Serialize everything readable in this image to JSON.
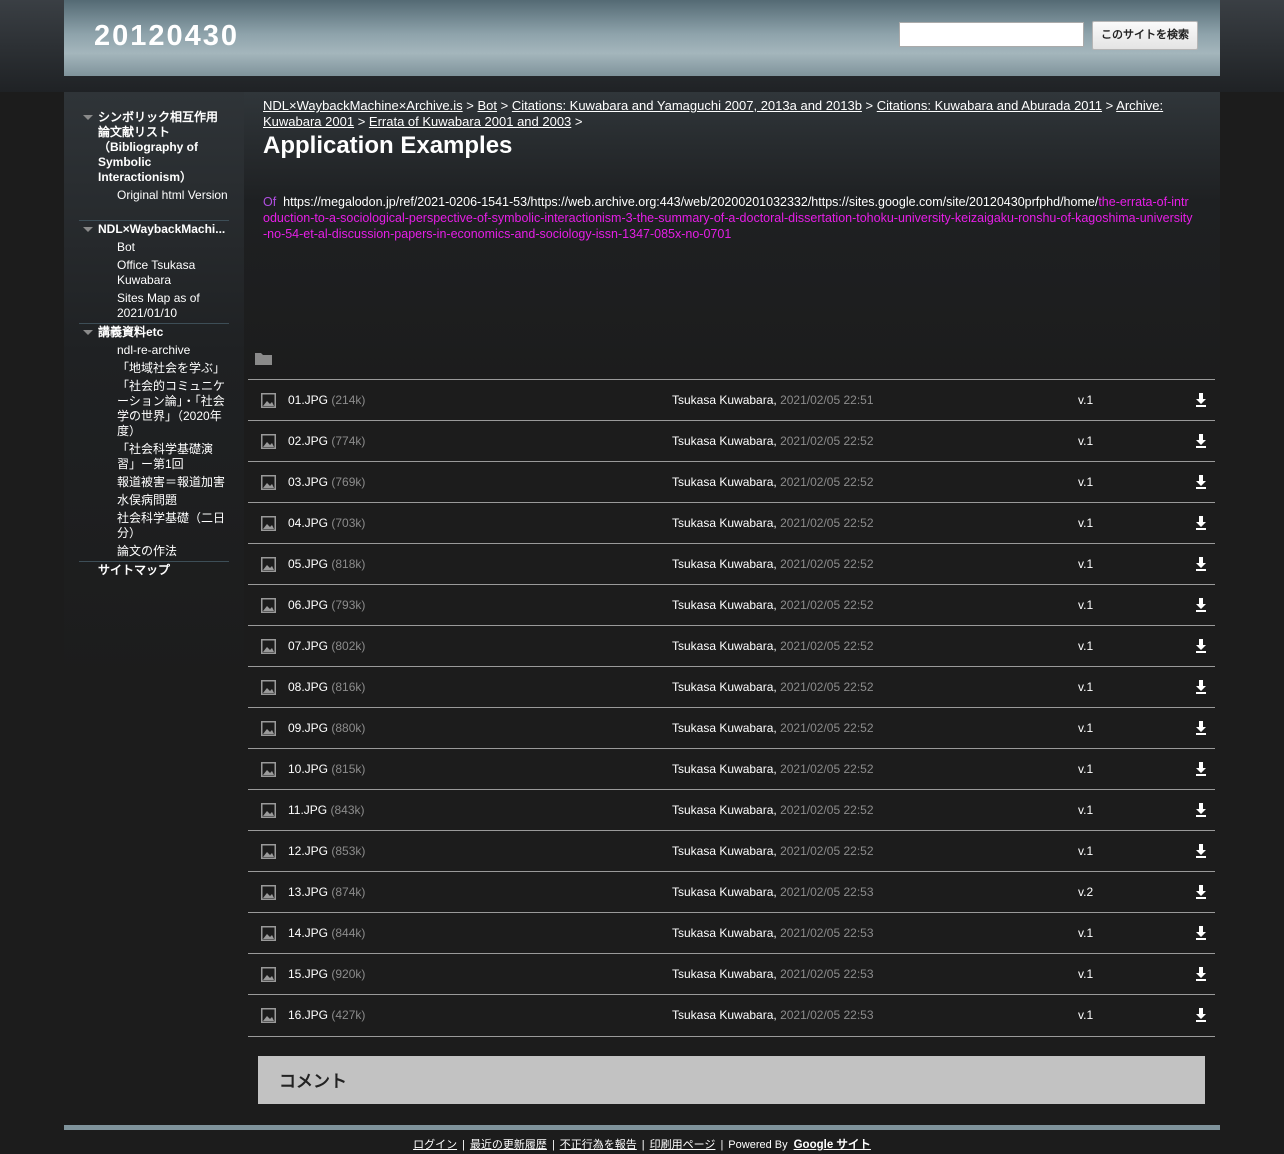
{
  "header": {
    "site_title": "20120430",
    "search_placeholder": "",
    "search_button": "このサイトを検索"
  },
  "sidebar": {
    "sections": [
      {
        "label": "シンボリック相互作用論文献リスト（Bibliography of Symbolic Interactionism）",
        "children": [
          "Original html Version"
        ]
      },
      {
        "label": "NDL×WaybackMachi...",
        "children": [
          "Bot",
          "Office Tsukasa Kuwabara",
          "Sites Map as of 2021/01/10"
        ]
      },
      {
        "label": "講義資料etc",
        "children": [
          "ndl-re-archive",
          "「地域社会を学ぶ」",
          "「社会的コミュニケーション論」・「社会学の世界」（2020年度）",
          "「社会科学基礎演習」ー第1回",
          "報道被害＝報道加害",
          "水俣病問題",
          "社会科学基礎（二日分）",
          "論文の作法"
        ]
      }
    ],
    "sitemap": "サイトマップ"
  },
  "breadcrumb": {
    "items": [
      "NDL×WaybackMachine×Archive.is",
      "Bot",
      "Citations: Kuwabara and Yamaguchi 2007, 2013a and 2013b",
      "Citations: Kuwabara and Aburada 2011",
      "Archive: Kuwabara 2001",
      "Errata of Kuwabara 2001 and 2003"
    ],
    "separator": ">"
  },
  "page": {
    "title": "Application Examples",
    "body_of": "Of",
    "body_url": "https://megalodon.jp/ref/2021-0206-1541-53/https://web.archive.org:443/web/20200201032332/https://sites.google.com/site/20120430prfphd/home/",
    "body_link": "the-errata-of-introduction-to-a-sociological-perspective-of-symbolic-interactionism-3-the-summary-of-a-doctoral-dissertation-tohoku-university-keizaigaku-ronshu-of-kagoshima-university-no-54-et-al-discussion-papers-in-economics-and-sociology-issn-1347-085x-no-0701"
  },
  "files": [
    {
      "name": "01.JPG",
      "size": "(214k)",
      "author": "Tsukasa Kuwabara,",
      "date": "2021/02/05 22:51",
      "version": "v.1"
    },
    {
      "name": "02.JPG",
      "size": "(774k)",
      "author": "Tsukasa Kuwabara,",
      "date": "2021/02/05 22:52",
      "version": "v.1"
    },
    {
      "name": "03.JPG",
      "size": "(769k)",
      "author": "Tsukasa Kuwabara,",
      "date": "2021/02/05 22:52",
      "version": "v.1"
    },
    {
      "name": "04.JPG",
      "size": "(703k)",
      "author": "Tsukasa Kuwabara,",
      "date": "2021/02/05 22:52",
      "version": "v.1"
    },
    {
      "name": "05.JPG",
      "size": "(818k)",
      "author": "Tsukasa Kuwabara,",
      "date": "2021/02/05 22:52",
      "version": "v.1"
    },
    {
      "name": "06.JPG",
      "size": "(793k)",
      "author": "Tsukasa Kuwabara,",
      "date": "2021/02/05 22:52",
      "version": "v.1"
    },
    {
      "name": "07.JPG",
      "size": "(802k)",
      "author": "Tsukasa Kuwabara,",
      "date": "2021/02/05 22:52",
      "version": "v.1"
    },
    {
      "name": "08.JPG",
      "size": "(816k)",
      "author": "Tsukasa Kuwabara,",
      "date": "2021/02/05 22:52",
      "version": "v.1"
    },
    {
      "name": "09.JPG",
      "size": "(880k)",
      "author": "Tsukasa Kuwabara,",
      "date": "2021/02/05 22:52",
      "version": "v.1"
    },
    {
      "name": "10.JPG",
      "size": "(815k)",
      "author": "Tsukasa Kuwabara,",
      "date": "2021/02/05 22:52",
      "version": "v.1"
    },
    {
      "name": "11.JPG",
      "size": "(843k)",
      "author": "Tsukasa Kuwabara,",
      "date": "2021/02/05 22:52",
      "version": "v.1"
    },
    {
      "name": "12.JPG",
      "size": "(853k)",
      "author": "Tsukasa Kuwabara,",
      "date": "2021/02/05 22:52",
      "version": "v.1"
    },
    {
      "name": "13.JPG",
      "size": "(874k)",
      "author": "Tsukasa Kuwabara,",
      "date": "2021/02/05 22:53",
      "version": "v.2"
    },
    {
      "name": "14.JPG",
      "size": "(844k)",
      "author": "Tsukasa Kuwabara,",
      "date": "2021/02/05 22:53",
      "version": "v.1"
    },
    {
      "name": "15.JPG",
      "size": "(920k)",
      "author": "Tsukasa Kuwabara,",
      "date": "2021/02/05 22:53",
      "version": "v.1"
    },
    {
      "name": "16.JPG",
      "size": "(427k)",
      "author": "Tsukasa Kuwabara,",
      "date": "2021/02/05 22:53",
      "version": "v.1"
    }
  ],
  "comments": {
    "title": "コメント"
  },
  "footer": {
    "links": [
      "ログイン",
      "最近の更新履歴",
      "不正行為を報告",
      "印刷用ページ"
    ],
    "powered_by": "Powered By",
    "brand": "Google サイト"
  },
  "icons": {
    "folder": "folder-icon",
    "file": "image-file-icon",
    "download": "download-arrow-icon",
    "expand": "triangle-down-icon"
  },
  "colors": {
    "header_gradient_mid": "#a4b6bc",
    "link_magenta": "#e61ee6",
    "of_purple": "#b04ee0",
    "comments_bg": "#c2c2c2"
  }
}
